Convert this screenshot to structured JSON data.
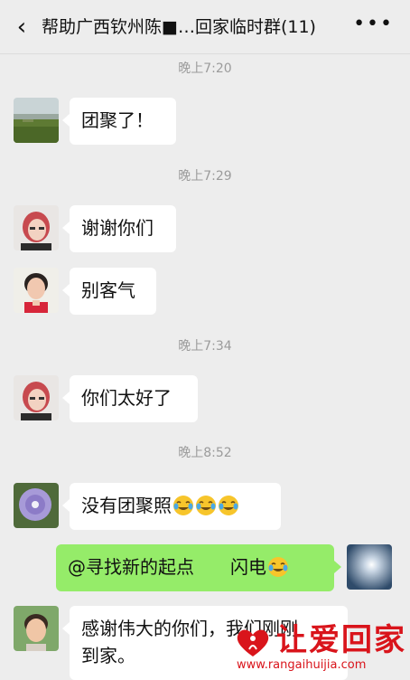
{
  "header": {
    "back_icon": "chevron-left-icon",
    "title": "帮助广西钦州陈■…回家临时群(11)",
    "more_icon": "ellipsis-icon",
    "more_label": "•••"
  },
  "messages": [
    {
      "type": "time",
      "text": "晚上7:20"
    },
    {
      "type": "left",
      "avatar": "landscape-avatar",
      "text": "团聚了！"
    },
    {
      "type": "time",
      "text": "晚上7:29"
    },
    {
      "type": "left",
      "avatar": "woman-red-hair-avatar",
      "text": "谢谢你们"
    },
    {
      "type": "left",
      "avatar": "woman-avatar",
      "text": "别客气"
    },
    {
      "type": "time",
      "text": "晚上7:34"
    },
    {
      "type": "left",
      "avatar": "woman-red-hair-avatar",
      "text": "你们太好了"
    },
    {
      "type": "time",
      "text": "晚上8:52"
    },
    {
      "type": "left",
      "avatar": "flower-avatar",
      "text": "没有团聚照",
      "emoji": "crying-laughing-emoji ×3"
    },
    {
      "type": "right",
      "avatar": "sky-avatar",
      "text": "@寻找新的起点　　闪电",
      "emoji": "crying-laughing-emoji"
    },
    {
      "type": "left",
      "avatar": "child-avatar",
      "text_line1": "感谢伟大的你们，我们刚刚",
      "text_line2": "到家。"
    }
  ],
  "watermark": {
    "text": "让爱回家",
    "url": "www.rangaihuijia.com",
    "color": "#d9141b"
  },
  "colors": {
    "background": "#ededed",
    "bubble_left": "#ffffff",
    "bubble_right": "#95ec69",
    "timestamp": "#9b9b9b"
  }
}
